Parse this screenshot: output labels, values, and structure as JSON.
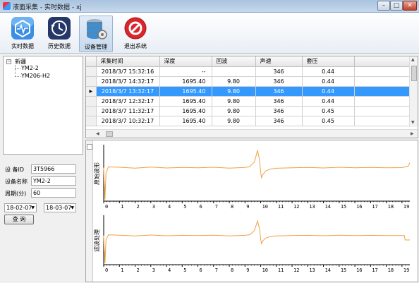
{
  "window": {
    "title": "液面采集 - 实时数据 - xj",
    "min": "–",
    "max": "□",
    "close": "✕"
  },
  "toolbar": {
    "items": [
      {
        "label": "实时数据",
        "icon": "monitor-icon",
        "color": "#3a8ee6"
      },
      {
        "label": "历史数据",
        "icon": "history-clock-icon",
        "color": "#2a3b6b"
      },
      {
        "label": "设备管理",
        "icon": "database-gear-icon",
        "color": "#3a8ee6"
      },
      {
        "label": "退出系统",
        "icon": "exit-icon",
        "color": "#d9262c"
      }
    ]
  },
  "tree": {
    "root": "新疆",
    "children": [
      "YM2-2",
      "YM206-H2"
    ],
    "expander": "−"
  },
  "form": {
    "device_id_label": "设  备ID",
    "device_id": "3T5966",
    "device_name_label": "设备名称",
    "device_name": "YM2-2",
    "period_label": "周期(分)",
    "period": "60",
    "start_date": "18-02-07",
    "end_date": "18-03-07",
    "query_button": "查  询"
  },
  "table": {
    "columns": [
      "采集时间",
      "深度",
      "回波",
      "声速",
      "套压"
    ],
    "selected_marker": "▶",
    "rows": [
      [
        "2018/3/7 15:32:16",
        "--",
        "",
        "346",
        "0.44"
      ],
      [
        "2018/3/7 14:32:17",
        "1695.40",
        "9.80",
        "346",
        "0.44"
      ],
      [
        "2018/3/7 13:32:17",
        "1695.40",
        "9.80",
        "346",
        "0.44"
      ],
      [
        "2018/3/7 12:32:17",
        "1695.40",
        "9.80",
        "346",
        "0.44"
      ],
      [
        "2018/3/7 11:32:17",
        "1695.40",
        "9.80",
        "346",
        "0.45"
      ],
      [
        "2018/3/7 10:32:17",
        "1695.40",
        "9.80",
        "346",
        "0.45"
      ]
    ],
    "selected_index": 2
  },
  "colors": {
    "trace": "#f0a040",
    "axis": "#000000",
    "selection": "#3399ff"
  },
  "chart_data": [
    {
      "type": "line",
      "ylabel": "原始波形",
      "xlim": [
        0,
        19.5
      ],
      "x_ticks": [
        0,
        1,
        2,
        3,
        4,
        5,
        6,
        7,
        8,
        9,
        10,
        11,
        12,
        13,
        14,
        15,
        16,
        17,
        18,
        19
      ],
      "series": [
        {
          "x": [
            0,
            0.03,
            0.08,
            0.15,
            0.3,
            1,
            2,
            3,
            4,
            5,
            6,
            7,
            8,
            9,
            9.3,
            9.6,
            9.8,
            9.92,
            10.0,
            10.05,
            10.15,
            10.3,
            10.6,
            11,
            12,
            13,
            14,
            15,
            16,
            17,
            18,
            19,
            19.4,
            19.5
          ],
          "y": [
            0,
            -0.9,
            -1.9,
            -0.3,
            0.05,
            0.03,
            -0.02,
            0.04,
            -0.01,
            0.02,
            0.0,
            0.03,
            -0.02,
            0.02,
            0.06,
            0.35,
            1.05,
            0.5,
            -0.25,
            -0.6,
            -0.4,
            -0.2,
            -0.08,
            -0.03,
            0.0,
            0.02,
            -0.01,
            0.03,
            0.0,
            0.02,
            0.0,
            0.01,
            0.1,
            0.3
          ]
        }
      ],
      "ylim": [
        -2,
        1.3
      ]
    },
    {
      "type": "line",
      "ylabel": "滤波处理",
      "xlim": [
        0,
        19.5
      ],
      "x_ticks": [
        0,
        1,
        2,
        3,
        4,
        5,
        6,
        7,
        8,
        9,
        10,
        11,
        12,
        13,
        14,
        15,
        16,
        17,
        18,
        19
      ],
      "series": [
        {
          "x": [
            0,
            0.03,
            0.08,
            0.15,
            0.3,
            1,
            2,
            3,
            4,
            5,
            6,
            7,
            8,
            9,
            9.3,
            9.6,
            9.8,
            9.92,
            10.0,
            10.05,
            10.15,
            10.3,
            10.6,
            11,
            12,
            13,
            14,
            15,
            16,
            17,
            18,
            19,
            19.15,
            19.2,
            19.5
          ],
          "y": [
            0,
            -0.9,
            -1.9,
            -0.3,
            0.05,
            0.03,
            -0.02,
            0.04,
            -0.01,
            0.02,
            0.0,
            0.03,
            -0.02,
            0.02,
            0.06,
            0.35,
            1.0,
            0.5,
            -0.25,
            -0.55,
            -0.35,
            -0.18,
            -0.07,
            -0.02,
            0.0,
            0.02,
            -0.01,
            0.03,
            0.0,
            0.02,
            0.0,
            0.0,
            0.0,
            -0.3,
            -0.3
          ]
        }
      ],
      "ylim": [
        -2,
        1.3
      ]
    }
  ]
}
